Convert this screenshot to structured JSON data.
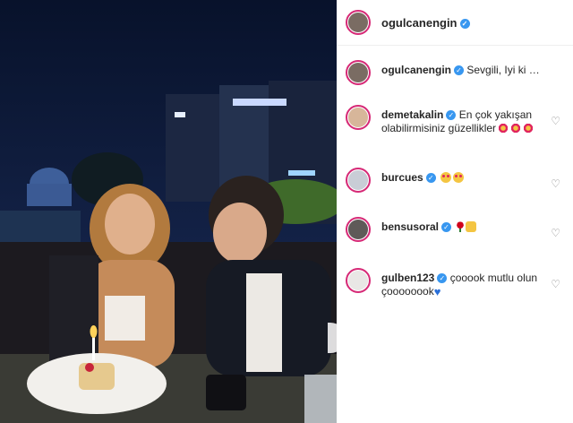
{
  "post": {
    "photo_alt": "photo",
    "author": "ogulcanengin",
    "caption_author": "ogulcanengin",
    "caption_text": "Sevgili, Iyi ki Doğdun..."
  },
  "comments": [
    {
      "user": "demetakalin",
      "text": "En çok yakışan olabilirmisiniz güzellikler",
      "emojis": [
        "flower",
        "flower",
        "flower"
      ]
    },
    {
      "user": "burcues",
      "text": "",
      "emojis": [
        "heart-eyes",
        "heart-eyes"
      ]
    },
    {
      "user": "bensusoral",
      "text": "",
      "emojis": [
        "rose",
        "clap"
      ]
    },
    {
      "user": "gulben123",
      "text": "çooook mutlu olun çoooooook",
      "emojis": [
        "blue-heart"
      ]
    }
  ],
  "icons": {
    "verified": "verified-badge-icon",
    "like": "heart-outline-icon",
    "next": "chevron-right-icon"
  },
  "colors": {
    "verified_blue": "#3897f0",
    "story_ring": "#d62976",
    "username": "#262626"
  }
}
